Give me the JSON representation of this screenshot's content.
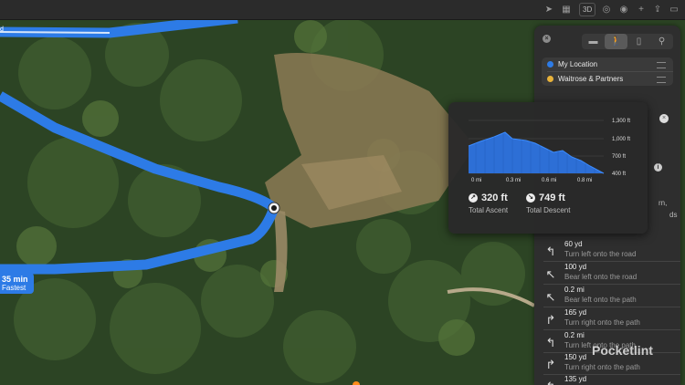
{
  "toolbar": {
    "three_d_label": "3D"
  },
  "route_badge": {
    "time": "35 min",
    "tag": "Fastest",
    "edge_label": "d"
  },
  "panel": {
    "modes": [
      "car-icon",
      "walk-icon",
      "transit-icon",
      "bike-icon"
    ],
    "stops": [
      {
        "label": "My Location",
        "color": "#2d7be6"
      },
      {
        "label": "Waitrose & Partners",
        "color": "#e8b23a"
      }
    ],
    "hidden_fragments": [
      "rn,",
      "ds"
    ],
    "steps": [
      {
        "distance": "60 yd",
        "instruction": "Turn left onto the road",
        "icon": "turn-left-icon",
        "glyph": "↰"
      },
      {
        "distance": "100 yd",
        "instruction": "Bear left onto the road",
        "icon": "bear-left-icon",
        "glyph": "↖"
      },
      {
        "distance": "0.2 mi",
        "instruction": "Bear left onto the path",
        "icon": "bear-left-icon",
        "glyph": "↖"
      },
      {
        "distance": "165 yd",
        "instruction": "Turn right onto the path",
        "icon": "turn-right-icon",
        "glyph": "↱"
      },
      {
        "distance": "0.2 mi",
        "instruction": "Turn left onto the path",
        "icon": "turn-left-icon",
        "glyph": "↰"
      },
      {
        "distance": "150 yd",
        "instruction": "Turn right onto the path",
        "icon": "turn-right-icon",
        "glyph": "↱"
      },
      {
        "distance": "135 yd",
        "instruction": "",
        "icon": "turn-left-icon",
        "glyph": "↰"
      }
    ]
  },
  "elevation": {
    "y_ticks": [
      "1,300 ft",
      "1,000 ft",
      "700 ft",
      "400 ft"
    ],
    "x_ticks": [
      "0 mi",
      "0.3 mi",
      "0.6 mi",
      "0.8 mi"
    ],
    "ascent_value": "320 ft",
    "ascent_label": "Total Ascent",
    "descent_value": "749 ft",
    "descent_label": "Total Descent"
  },
  "watermark": "Pocketlint"
}
